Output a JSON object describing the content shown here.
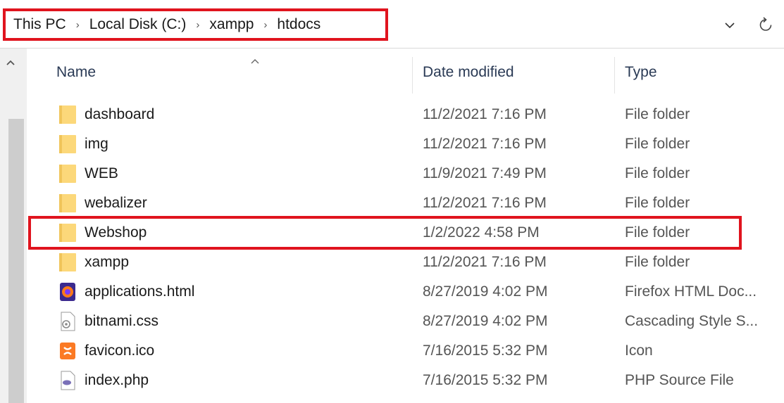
{
  "address_bar": {
    "breadcrumbs": [
      "This PC",
      "Local Disk (C:)",
      "xampp",
      "htdocs"
    ],
    "dropdown_icon": "chevron-down-icon",
    "refresh_icon": "refresh-icon"
  },
  "columns": {
    "name": "Name",
    "date_modified": "Date modified",
    "type": "Type"
  },
  "files": [
    {
      "name": "dashboard",
      "date": "11/2/2021 7:16 PM",
      "type": "File folder",
      "icon": "folder-icon"
    },
    {
      "name": "img",
      "date": "11/2/2021 7:16 PM",
      "type": "File folder",
      "icon": "folder-icon"
    },
    {
      "name": "WEB",
      "date": "11/9/2021 7:49 PM",
      "type": "File folder",
      "icon": "folder-icon"
    },
    {
      "name": "webalizer",
      "date": "11/2/2021 7:16 PM",
      "type": "File folder",
      "icon": "folder-icon"
    },
    {
      "name": "Webshop",
      "date": "1/2/2022 4:58 PM",
      "type": "File folder",
      "icon": "folder-icon"
    },
    {
      "name": "xampp",
      "date": "11/2/2021 7:16 PM",
      "type": "File folder",
      "icon": "folder-icon"
    },
    {
      "name": "applications.html",
      "date": "8/27/2019 4:02 PM",
      "type": "Firefox HTML Doc...",
      "icon": "firefox-icon"
    },
    {
      "name": "bitnami.css",
      "date": "8/27/2019 4:02 PM",
      "type": "Cascading Style S...",
      "icon": "css-file-icon"
    },
    {
      "name": "favicon.ico",
      "date": "7/16/2015 5:32 PM",
      "type": "Icon",
      "icon": "xampp-icon"
    },
    {
      "name": "index.php",
      "date": "7/16/2015 5:32 PM",
      "type": "PHP Source File",
      "icon": "php-file-icon"
    }
  ],
  "colors": {
    "highlight": "#e0141e",
    "folder": "#fcd87a"
  }
}
